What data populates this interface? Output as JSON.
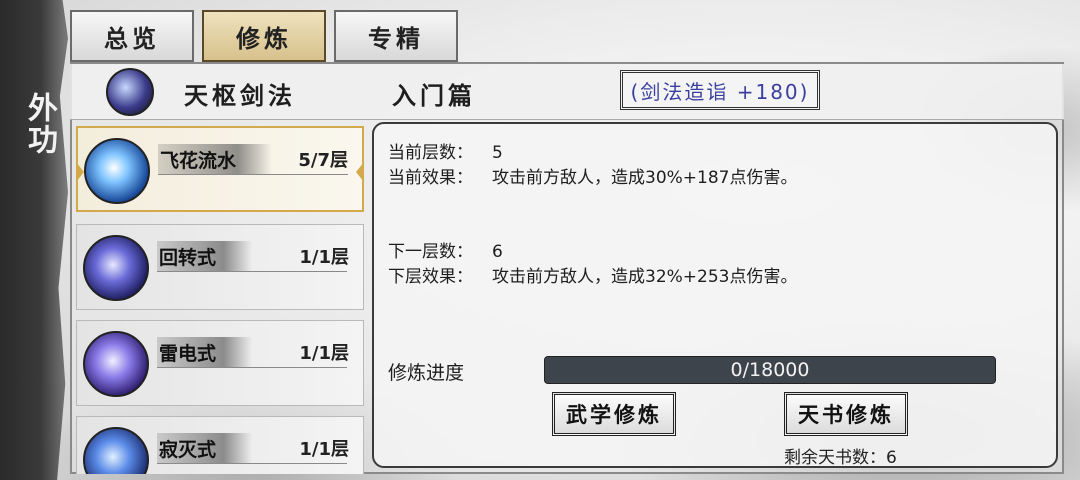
{
  "side_label": "外功",
  "tabs": [
    {
      "label": "总览",
      "active": false
    },
    {
      "label": "修炼",
      "active": true
    },
    {
      "label": "专精",
      "active": false
    }
  ],
  "header": {
    "skill_name": "天枢剑法",
    "chapter": "入门篇",
    "mastery": "(剑法造诣 +180)"
  },
  "skills": [
    {
      "name": "飞花流水",
      "level": "5/7层",
      "selected": true,
      "icon": "flying-blossom-icon"
    },
    {
      "name": "回转式",
      "level": "1/1层",
      "selected": false,
      "icon": "spin-slash-icon"
    },
    {
      "name": "雷电式",
      "level": "1/1层",
      "selected": false,
      "icon": "lightning-icon"
    },
    {
      "name": "寂灭式",
      "level": "1/1层",
      "selected": false,
      "icon": "nirvana-icon"
    }
  ],
  "detail": {
    "current_layer_label": "当前层数：",
    "current_layer_value": "5",
    "current_effect_label": "当前效果：",
    "current_effect_value": "攻击前方敌人，造成30%+187点伤害。",
    "next_layer_label": "下一层数：",
    "next_layer_value": "6",
    "next_effect_label": "下层效果：",
    "next_effect_value": "攻击前方敌人，造成32%+253点伤害。",
    "progress_label": "修炼进度",
    "progress_text": "0/18000",
    "progress_fraction": 0
  },
  "buttons": {
    "martial_train": "武学修炼",
    "tianshu_train": "天书修炼"
  },
  "remaining_books": "剩余天书数：6",
  "colors": {
    "active_tab": "#d7c18c",
    "selected_border": "#d4a94c",
    "mastery_text": "#3a3fa0",
    "progress_bg": "#3e444c"
  }
}
